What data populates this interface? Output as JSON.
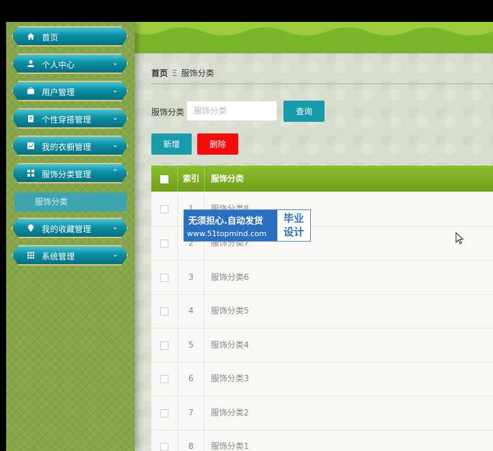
{
  "sidebar": {
    "items": [
      {
        "label": "首页",
        "icon": "home-icon",
        "chevron": ""
      },
      {
        "label": "个人中心",
        "icon": "user-icon",
        "chevron": "⌄"
      },
      {
        "label": "用户管理",
        "icon": "briefcase-icon",
        "chevron": "⌄"
      },
      {
        "label": "个性穿搭管理",
        "icon": "clipboard-icon",
        "chevron": "⌄"
      },
      {
        "label": "我的衣橱管理",
        "icon": "chart-icon",
        "chevron": "⌄"
      },
      {
        "label": "服饰分类管理",
        "icon": "grid-icon",
        "chevron": "⌃"
      },
      {
        "label": "我的收藏管理",
        "icon": "bulb-icon",
        "chevron": "⌄"
      },
      {
        "label": "系统管理",
        "icon": "apps-icon",
        "chevron": "⌄"
      }
    ],
    "subitem": "服饰分类"
  },
  "breadcrumb": {
    "home": "首页",
    "separator": "Ξ",
    "current": "服饰分类"
  },
  "search": {
    "label": "服饰分类",
    "placeholder": "服饰分类",
    "query_button": "查询"
  },
  "actions": {
    "add": "新增",
    "delete": "删除"
  },
  "table": {
    "headers": {
      "index": "索引",
      "category": "服饰分类"
    },
    "rows": [
      {
        "index": "1",
        "category": "服饰分类8"
      },
      {
        "index": "2",
        "category": "服饰分类7"
      },
      {
        "index": "3",
        "category": "服饰分类6"
      },
      {
        "index": "4",
        "category": "服饰分类5"
      },
      {
        "index": "5",
        "category": "服饰分类4"
      },
      {
        "index": "6",
        "category": "服饰分类3"
      },
      {
        "index": "7",
        "category": "服饰分类2"
      },
      {
        "index": "8",
        "category": "服饰分类1"
      }
    ]
  },
  "watermark": {
    "main": "无须担心.自动发货",
    "url": "www.51topmind.com",
    "line1": "毕业",
    "line2": "设计"
  },
  "colors": {
    "teal": "#1a9bab",
    "red": "#f70a0a",
    "green": "#7ab62c",
    "sidebar": "#86a648"
  }
}
